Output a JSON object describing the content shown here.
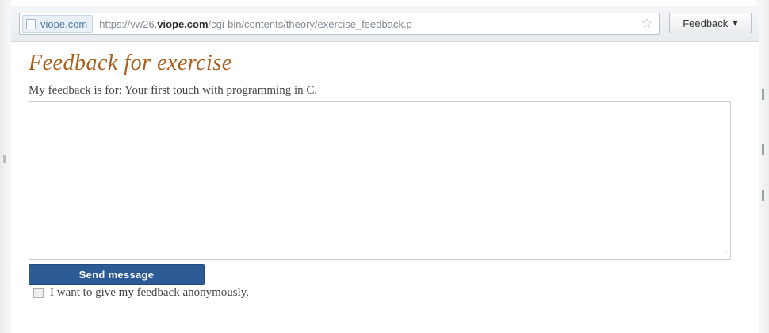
{
  "browser": {
    "site_label": "viope.com",
    "url_prefix": "https://vw26.",
    "url_host": "viope.com",
    "url_path": "/cgi-bin/contents/theory/exercise_feedback.p",
    "menu_label": "Feedback",
    "menu_caret": "▾",
    "star_glyph": "☆"
  },
  "form": {
    "title": "Feedback for exercise",
    "subject": "My feedback is for: Your first touch with programming in C.",
    "message_value": "",
    "grip": "..:",
    "send_label": "Send message",
    "anonymous_label": "I want to give my feedback anonymously.",
    "anonymous_checked": false
  },
  "colors": {
    "title": "#a8601c",
    "button": "#2c5a95",
    "link": "#4b76a8"
  }
}
